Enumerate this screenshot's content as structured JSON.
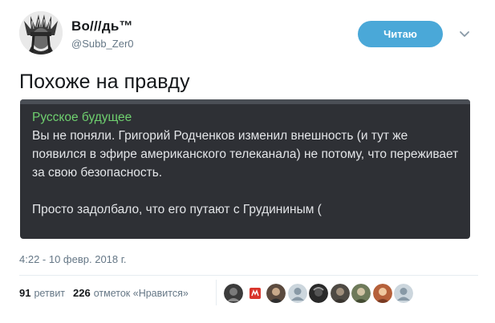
{
  "author": {
    "name": "Во///дь™",
    "handle": "@Subb_Zer0"
  },
  "follow_button": "Читаю",
  "tweet": {
    "text": "Похоже на правду"
  },
  "embedded": {
    "title": "Русское будущее",
    "paragraph1": "Вы не поняли. Григорий Родченков изменил внешность (и тут же появился в эфире американского телеканала) не потому, что переживает за свою безопасность.",
    "paragraph2": "Просто задолбало, что его путают с Грудининым ("
  },
  "timestamp": "4:22 - 10 февр. 2018 г.",
  "stats": {
    "retweets_count": "91",
    "retweets_label": "ретвит",
    "likes_count": "226",
    "likes_label": "отметок «Нравится»"
  },
  "colors": {
    "follow_bg": "#4aa8d8",
    "card_bg": "#2e3035",
    "card_title": "#6fd06f",
    "card_text": "#e3e5e8"
  },
  "liker_avatars": [
    "dark-avatar",
    "red-logo-avatar",
    "photo-avatar",
    "default-egg-avatar",
    "photo-avatar",
    "photo-avatar",
    "photo-avatar",
    "photo-avatar",
    "default-egg-avatar"
  ]
}
